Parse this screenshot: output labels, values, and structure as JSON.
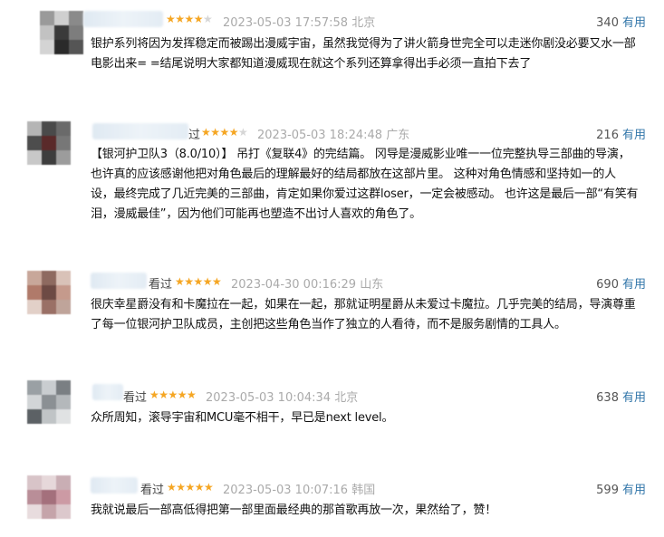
{
  "reviews": [
    {
      "name_suffix": "",
      "rating": 4,
      "date": "2023-05-03 17:57:58",
      "location": "北京",
      "votes": "340",
      "useful_label": "有用",
      "lines": [
        "银护系列将因为发挥稳定而被踢出漫威宇宙，虽然我觉得为了讲火箭身世完全可以走迷你剧没必要又水一部",
        "电影出来= =结尾说明大家都知道漫威现在就这个系列还算拿得出手必须一直拍下去了"
      ]
    },
    {
      "name_suffix": "过",
      "rating": 4,
      "date": "2023-05-03 18:24:48",
      "location": "广东",
      "votes": "216",
      "useful_label": "有用",
      "lines": [
        "【银河护卫队3（8.0/10）】 吊打《复联4》的完结篇。 冈导是漫威影业唯一一位完整执导三部曲的导演，",
        "也许真的应该感谢他把对角色最后的理解最好的结局都放在这部片里。 这种对角色情感和坚持如一的人",
        "设，最终完成了几近完美的三部曲，肯定如果你爱过这群loser，一定会被感动。 也许这是最后一部“有笑有",
        "泪，漫威最佳”，因为他们可能再也塑造不出讨人喜欢的角色了。"
      ]
    },
    {
      "name_suffix": "看过",
      "rating": 5,
      "date": "2023-04-30 00:16:29",
      "location": "山东",
      "votes": "690",
      "useful_label": "有用",
      "lines": [
        "很庆幸星爵没有和卡魔拉在一起，如果在一起，那就证明星爵从未爱过卡魔拉。几乎完美的结局，导演尊重",
        "了每一位银河护卫队成员，主创把这些角色当作了独立的人看待，而不是服务剧情的工具人。"
      ]
    },
    {
      "name_suffix": "看过",
      "rating": 5,
      "date": "2023-05-03 10:04:34",
      "location": "北京",
      "votes": "638",
      "useful_label": "有用",
      "lines": [
        "众所周知，滚导宇宙和MCU毫不相干，早已是next level。"
      ]
    },
    {
      "name_suffix": "看过",
      "rating": 5,
      "date": "2023-05-03 10:07:16",
      "location": "韩国",
      "votes": "599",
      "useful_label": "有用",
      "lines": [
        "我就说最后一部高低得把第一部里面最经典的那首歌再放一次，果然给了，赞！"
      ]
    }
  ]
}
